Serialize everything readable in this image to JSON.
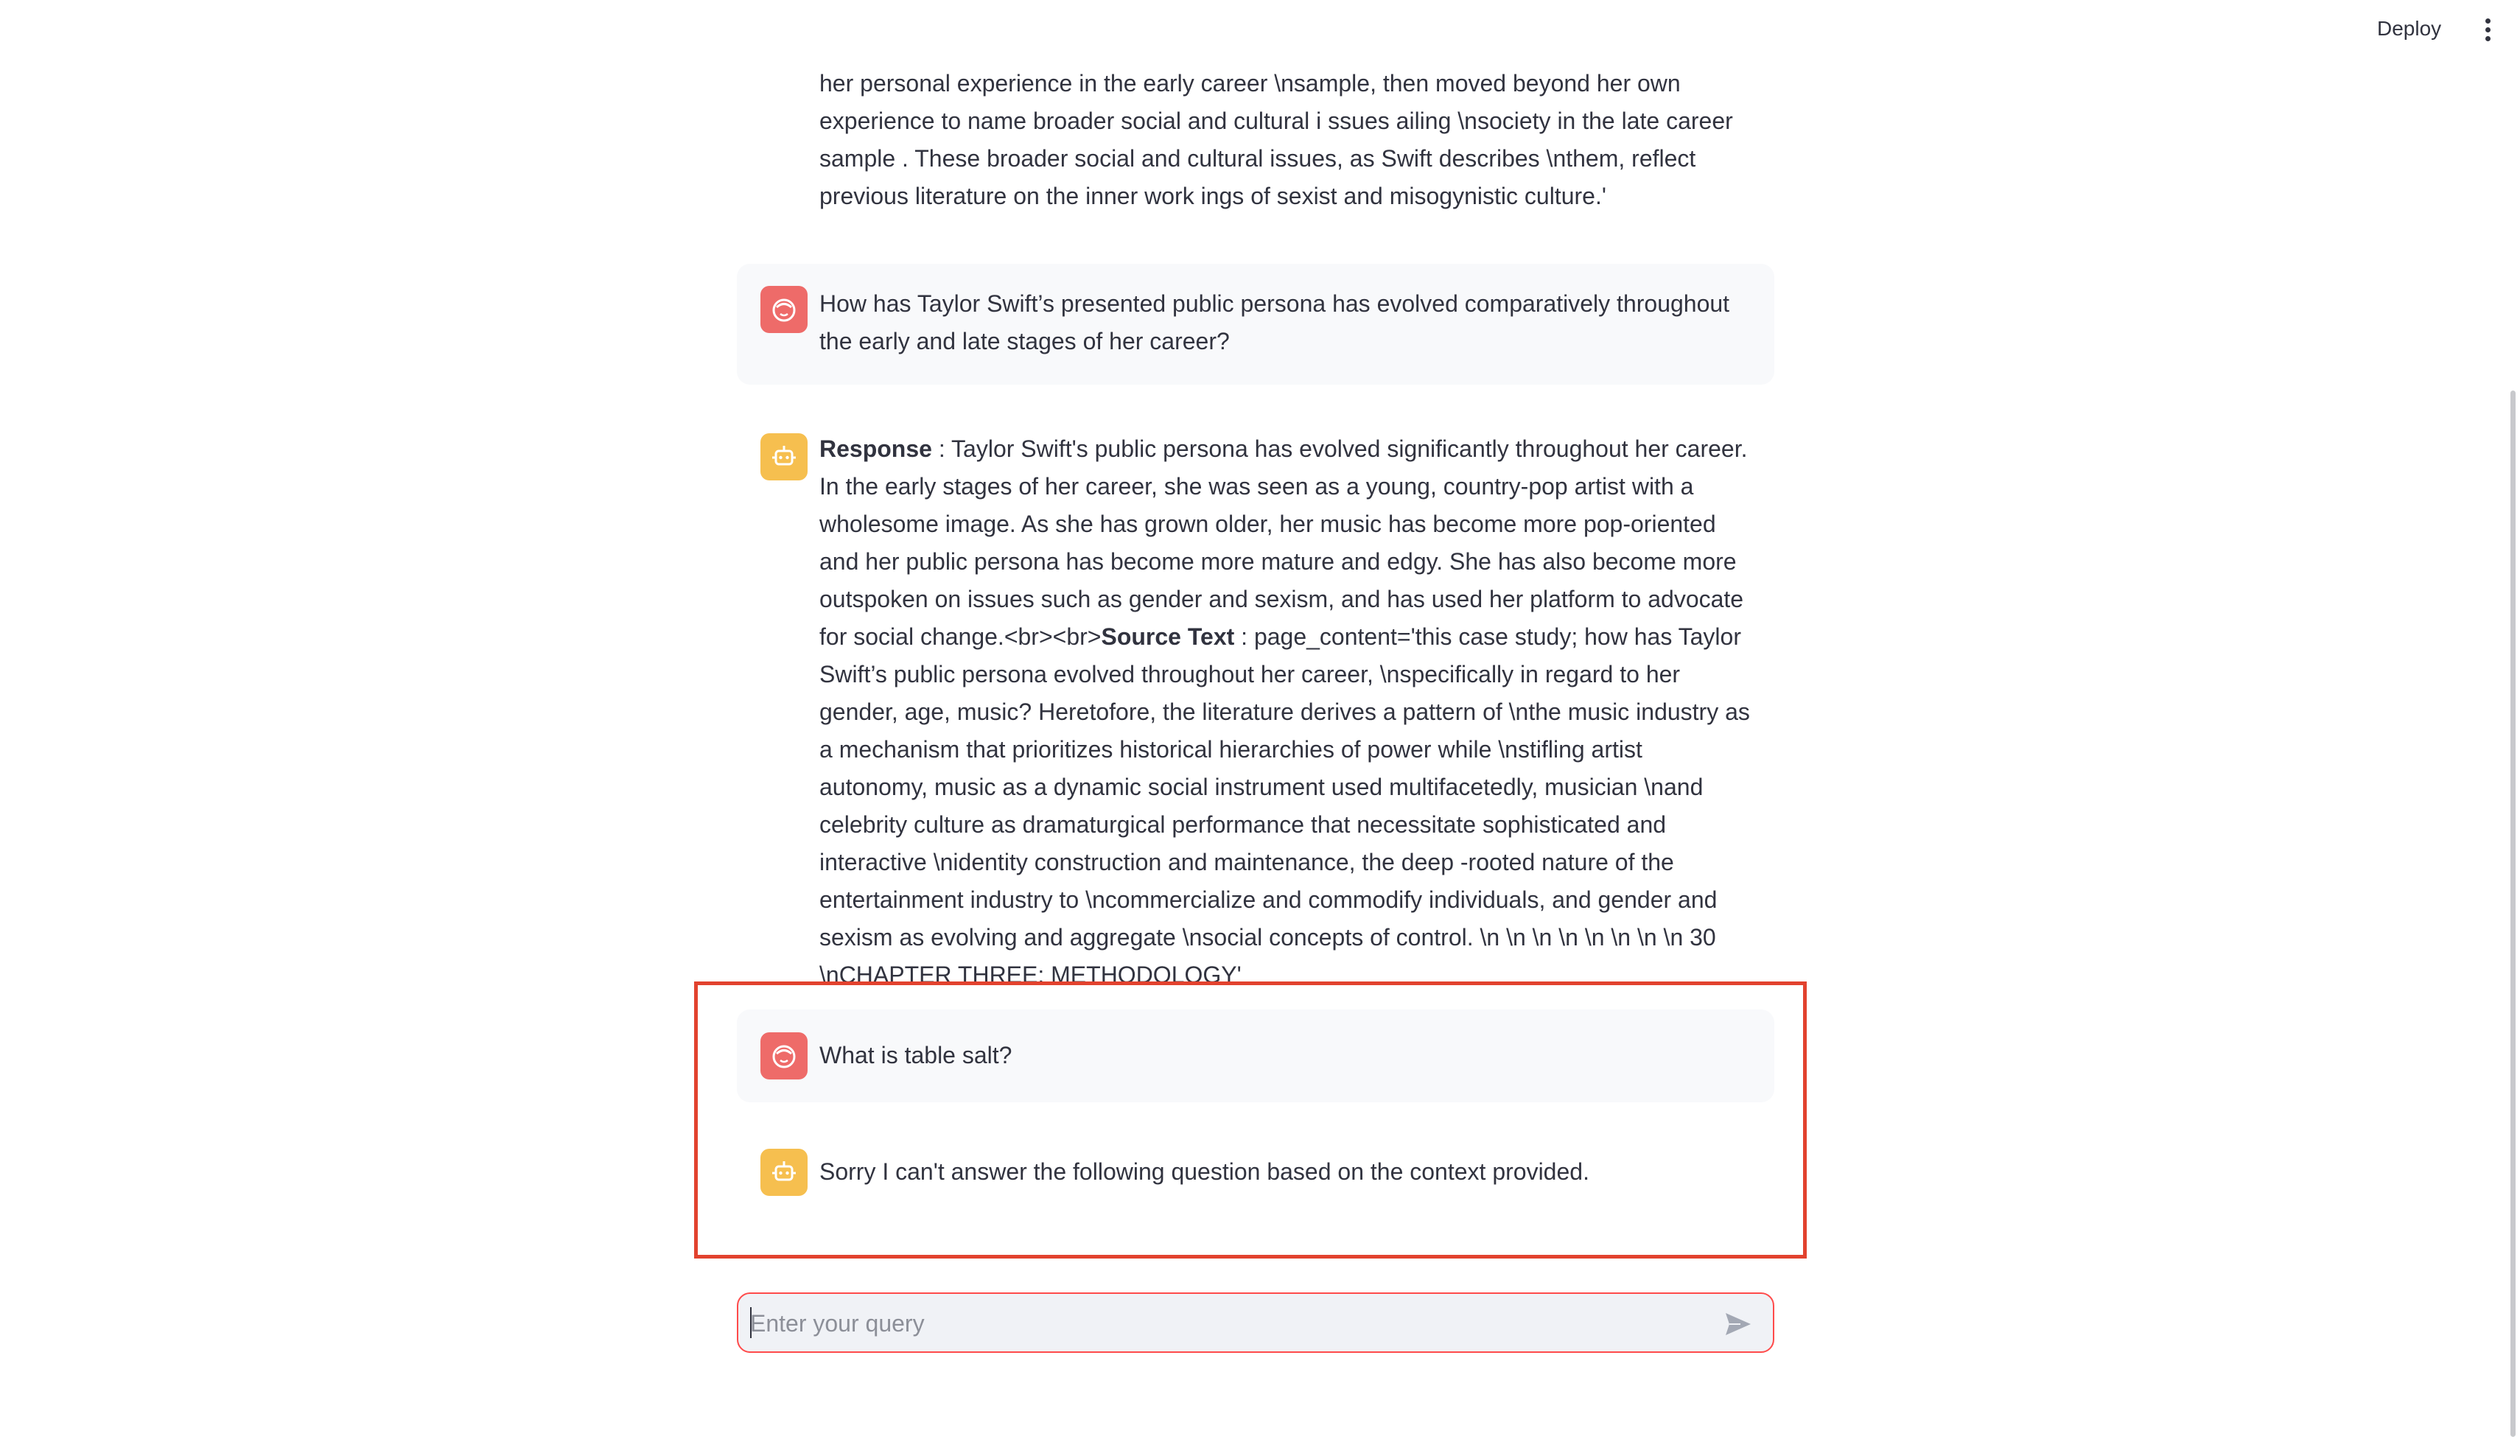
{
  "header": {
    "deploy_label": "Deploy",
    "menu_icon": "vertical-dots-icon"
  },
  "messages": [
    {
      "role": "assistant",
      "partial": true,
      "text": "her personal experience in the early career \\nsample, then moved beyond her own experience to name broader social and cultural i ssues ailing \\nsociety in the late career sample . These broader social and cultural issues, as Swift describes \\nthem, reflect previous literature on the inner work ings of sexist and misogynistic culture.'"
    },
    {
      "role": "user",
      "avatar_icon": "user-face-icon",
      "text": "How has Taylor Swift’s presented public persona has evolved comparatively throughout the early and late stages of her career?"
    },
    {
      "role": "assistant",
      "avatar_icon": "robot-icon",
      "response_label": "Response",
      "response_text": " : Taylor Swift's public persona has evolved significantly throughout her career. In the early stages of her career, she was seen as a young, country-pop artist with a wholesome image. As she has grown older, her music has become more pop-oriented and her public persona has become more mature and edgy. She has also become more outspoken on issues such as gender and sexism, and has used her platform to advocate for social change.<br><br>",
      "source_label": "Source Text",
      "source_text": " : page_content='this case study; how has Taylor Swift’s public persona evolved throughout her career, \\nspecifically in regard to her gender, age, music? Heretofore, the literature derives a pattern of \\nthe music industry as a mechanism that prioritizes historical hierarchies of power while \\nstifling artist autonomy, music as a dynamic social instrument used multifacetedly, musician \\nand celebrity culture as dramaturgical performance that necessitate sophisticated and interactive \\nidentity construction and maintenance, the deep -rooted nature of the entertainment industry to \\ncommercialize and commodify individuals, and gender and sexism as evolving and aggregate \\nsocial concepts of control. \\n \\n \\n \\n \\n \\n \\n \\n 30 \\nCHAPTER THREE: METHODOLOGY'"
    },
    {
      "role": "user",
      "avatar_icon": "user-face-icon",
      "text": "What is table salt?"
    },
    {
      "role": "assistant",
      "avatar_icon": "robot-icon",
      "text": "Sorry I can't answer the following question based on the context provided."
    }
  ],
  "chat_input": {
    "placeholder": "Enter your query",
    "value": "",
    "send_icon": "send-arrow-icon"
  },
  "colors": {
    "user_avatar": "#ee6b69",
    "assistant_avatar": "#f6bf4f",
    "highlight_border": "#e2422e",
    "input_border": "#ff4b4b",
    "user_message_bg": "#f8f9fb"
  }
}
